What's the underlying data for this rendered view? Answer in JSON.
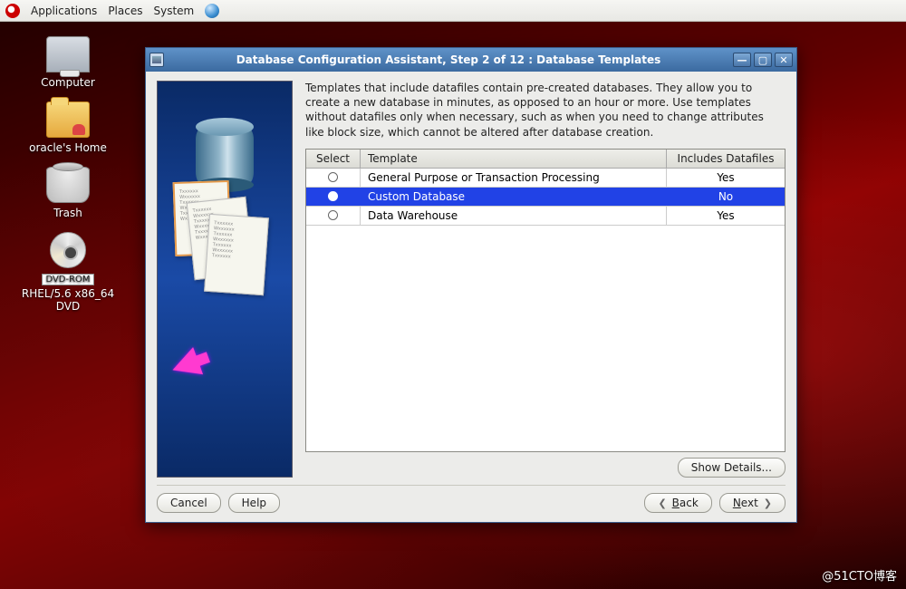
{
  "taskbar": {
    "menus": [
      "Applications",
      "Places",
      "System"
    ]
  },
  "desktop": {
    "computer": "Computer",
    "home": "oracle's Home",
    "trash": "Trash",
    "dvd_tag": "DVD-ROM",
    "dvd_label": "RHEL/5.6 x86_64 DVD"
  },
  "window": {
    "title": "Database Configuration Assistant, Step 2 of 12 : Database Templates",
    "description": "Templates that include datafiles contain pre-created databases. They allow you to create a new database in minutes, as opposed to an hour or more. Use templates without datafiles only when necessary, such as when you need to change attributes like block size, which cannot be altered after database creation.",
    "columns": {
      "select": "Select",
      "template": "Template",
      "includes": "Includes Datafiles"
    },
    "rows": [
      {
        "template": "General Purpose or Transaction Processing",
        "includes": "Yes",
        "selected": false
      },
      {
        "template": "Custom Database",
        "includes": "No",
        "selected": true
      },
      {
        "template": "Data Warehouse",
        "includes": "Yes",
        "selected": false
      }
    ],
    "buttons": {
      "show_details": "Show Details...",
      "cancel": "Cancel",
      "help": "Help",
      "back": "Back",
      "next": "Next"
    }
  },
  "watermark": "@51CTO博客"
}
